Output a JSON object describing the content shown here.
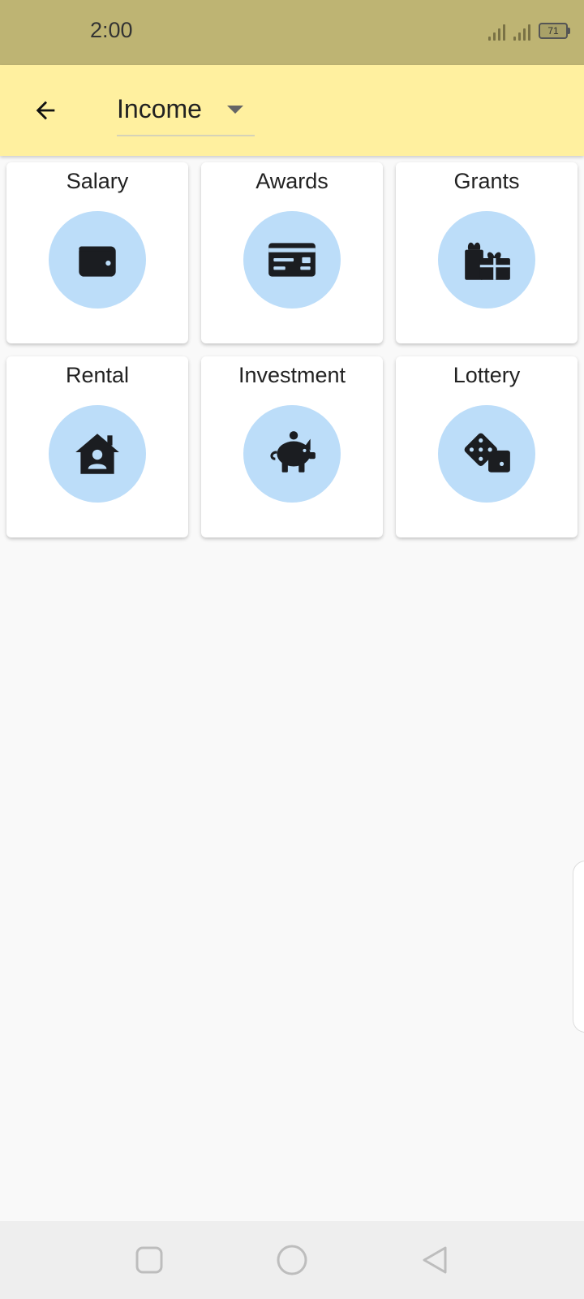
{
  "status_bar": {
    "time": "2:00",
    "battery": "71"
  },
  "app_bar": {
    "back_icon": "arrow-back-icon",
    "category_value": "Income"
  },
  "categories": [
    {
      "label": "Salary",
      "icon": "wallet-icon"
    },
    {
      "label": "Awards",
      "icon": "credit-card-icon"
    },
    {
      "label": "Grants",
      "icon": "gifts-icon"
    },
    {
      "label": "Rental",
      "icon": "house-user-icon"
    },
    {
      "label": "Investment",
      "icon": "piggy-bank-icon"
    },
    {
      "label": "Lottery",
      "icon": "dice-icon"
    }
  ],
  "colors": {
    "status_bar": "#beb473",
    "app_bar": "#fff09f",
    "icon_circle": "#bcddf9",
    "icon": "#1b1d21",
    "background": "#f9f9f9"
  }
}
